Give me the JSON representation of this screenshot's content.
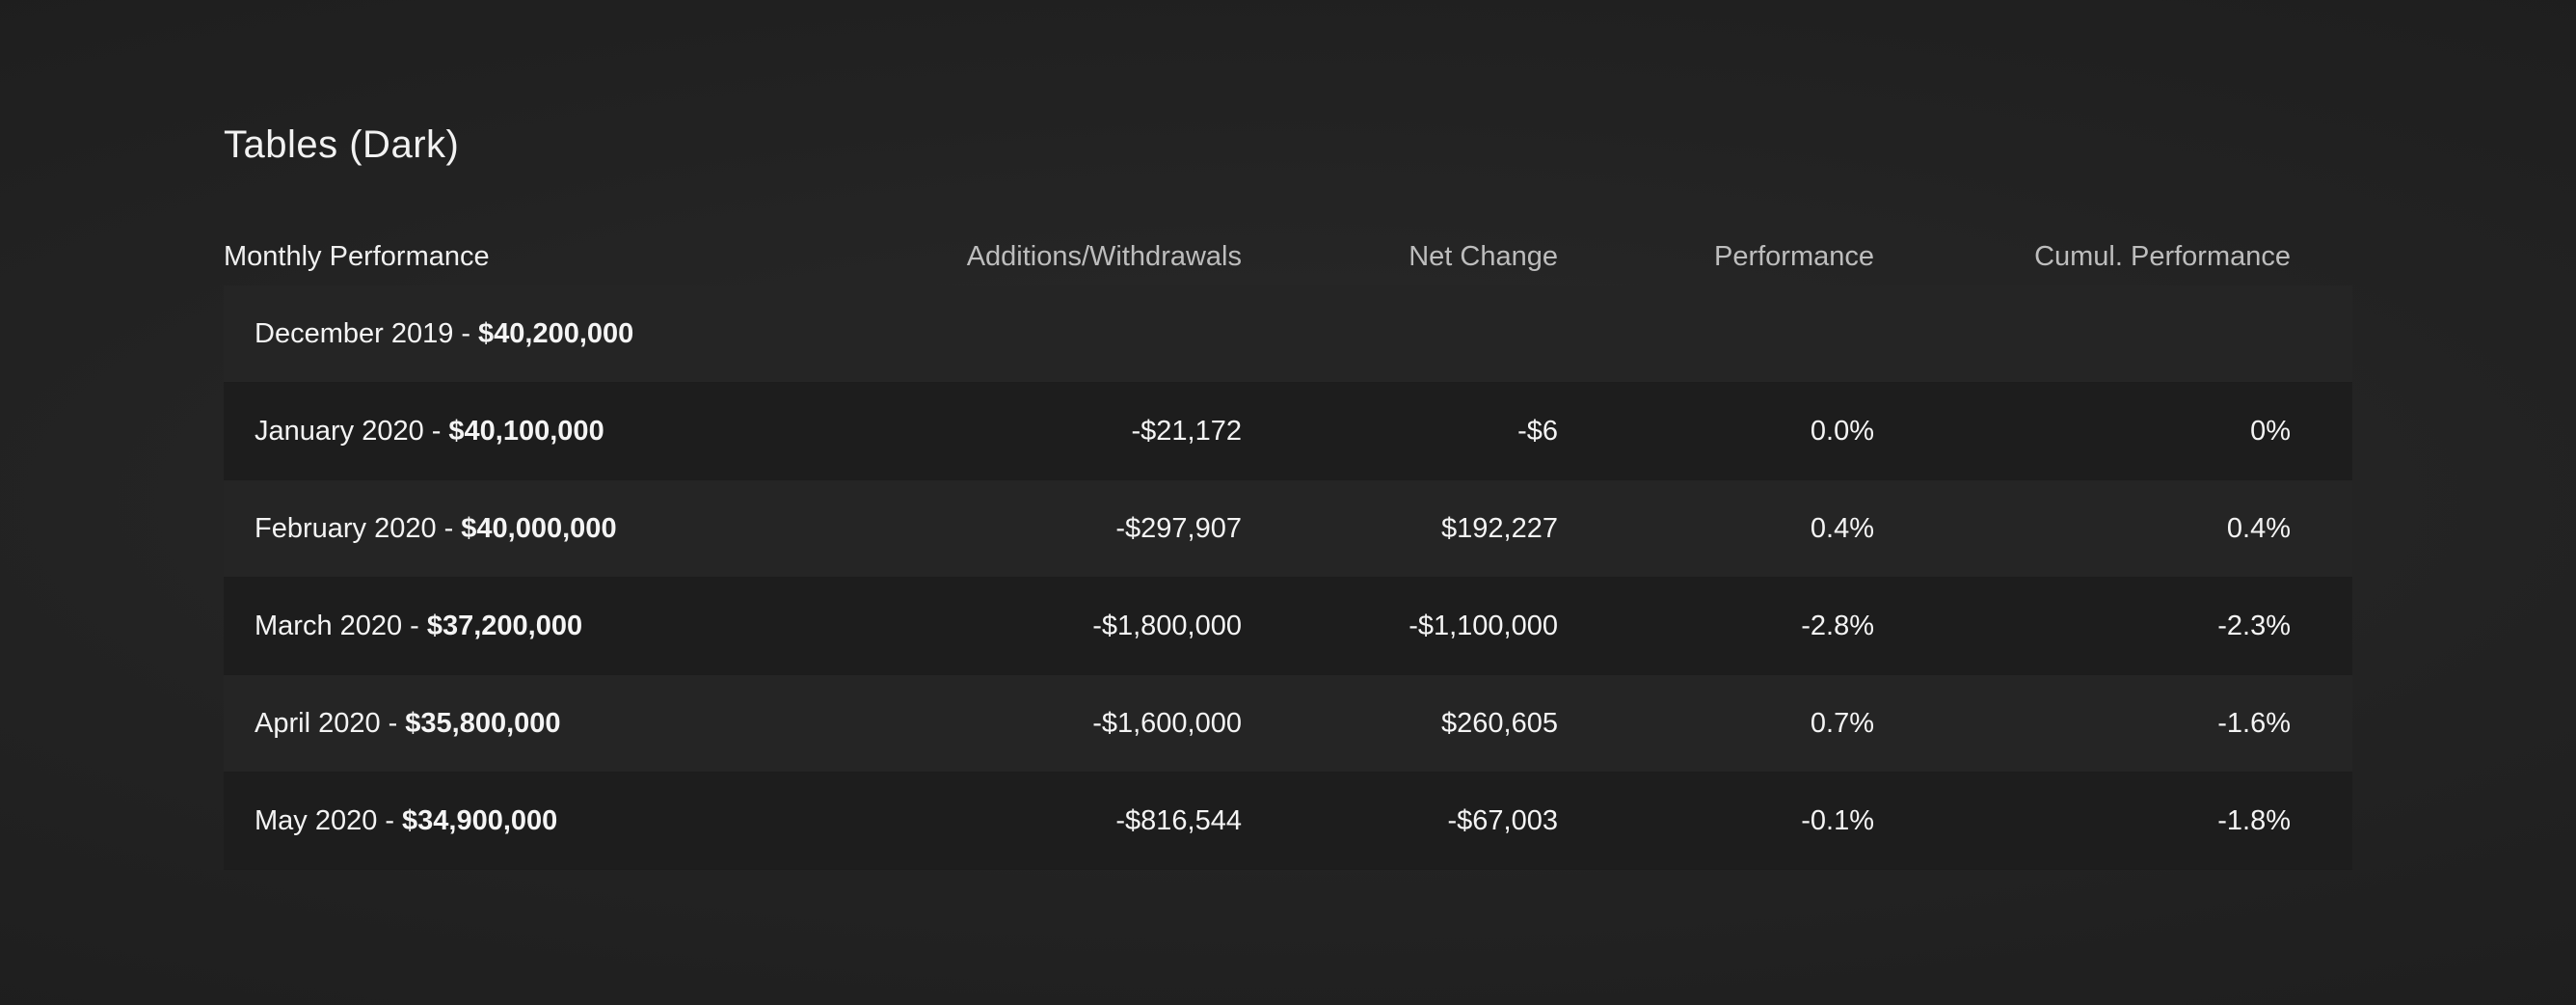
{
  "page": {
    "title": "Tables (Dark)"
  },
  "table": {
    "headers": {
      "monthly": "Monthly Performance",
      "additions": "Additions/Withdrawals",
      "net_change": "Net Change",
      "performance": "Performance",
      "cumulative": "Cumul. Performance"
    },
    "rows": [
      {
        "month": "December 2019",
        "separator": "-",
        "balance": "$40,200,000",
        "additions": "",
        "net_change": "",
        "performance": "",
        "cumulative": ""
      },
      {
        "month": "January 2020",
        "separator": "-",
        "balance": "$40,100,000",
        "additions": "-$21,172",
        "net_change": "-$6",
        "performance": "0.0%",
        "cumulative": "0%"
      },
      {
        "month": "February 2020",
        "separator": "-",
        "balance": "$40,000,000",
        "additions": "-$297,907",
        "net_change": "$192,227",
        "performance": "0.4%",
        "cumulative": "0.4%"
      },
      {
        "month": "March 2020",
        "separator": "-",
        "balance": "$37,200,000",
        "additions": "-$1,800,000",
        "net_change": "-$1,100,000",
        "performance": "-2.8%",
        "cumulative": "-2.3%"
      },
      {
        "month": "April 2020",
        "separator": "-",
        "balance": "$35,800,000",
        "additions": "-$1,600,000",
        "net_change": "$260,605",
        "performance": "0.7%",
        "cumulative": "-1.6%"
      },
      {
        "month": "May 2020",
        "separator": "-",
        "balance": "$34,900,000",
        "additions": "-$816,544",
        "net_change": "-$67,003",
        "performance": "-0.1%",
        "cumulative": "-1.8%"
      }
    ]
  },
  "colors": {
    "background": "#222222",
    "row_light": "#252525",
    "row_dark": "#1d1d1d",
    "header_text": "#bdbdbd",
    "cell_text": "#f4f4f4"
  }
}
